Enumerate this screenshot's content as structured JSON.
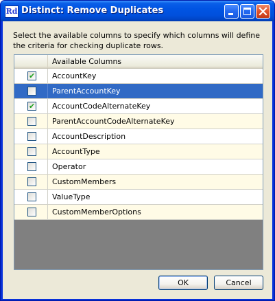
{
  "window": {
    "title": "Distinct: Remove Duplicates",
    "app_icon_text": "Rd"
  },
  "description": "Select the available columns to specify which columns will define the criteria for checking duplicate rows.",
  "grid": {
    "header": "Available Columns",
    "rows": [
      {
        "label": "AccountKey",
        "checked": true,
        "selected": false
      },
      {
        "label": "ParentAccountKey",
        "checked": false,
        "selected": true
      },
      {
        "label": "AccountCodeAlternateKey",
        "checked": true,
        "selected": false
      },
      {
        "label": "ParentAccountCodeAlternateKey",
        "checked": false,
        "selected": false
      },
      {
        "label": "AccountDescription",
        "checked": false,
        "selected": false
      },
      {
        "label": "AccountType",
        "checked": false,
        "selected": false
      },
      {
        "label": "Operator",
        "checked": false,
        "selected": false
      },
      {
        "label": "CustomMembers",
        "checked": false,
        "selected": false
      },
      {
        "label": "ValueType",
        "checked": false,
        "selected": false
      },
      {
        "label": "CustomMemberOptions",
        "checked": false,
        "selected": false
      }
    ]
  },
  "buttons": {
    "ok": "OK",
    "cancel": "Cancel"
  },
  "icons": {
    "check": "✔",
    "minimize": "minimize-icon",
    "maximize": "maximize-icon",
    "close": "close-icon"
  },
  "colors": {
    "title_bar": "#0054e3",
    "selection": "#316ac5",
    "alt_row": "#fffbe6",
    "check": "#21a121"
  }
}
